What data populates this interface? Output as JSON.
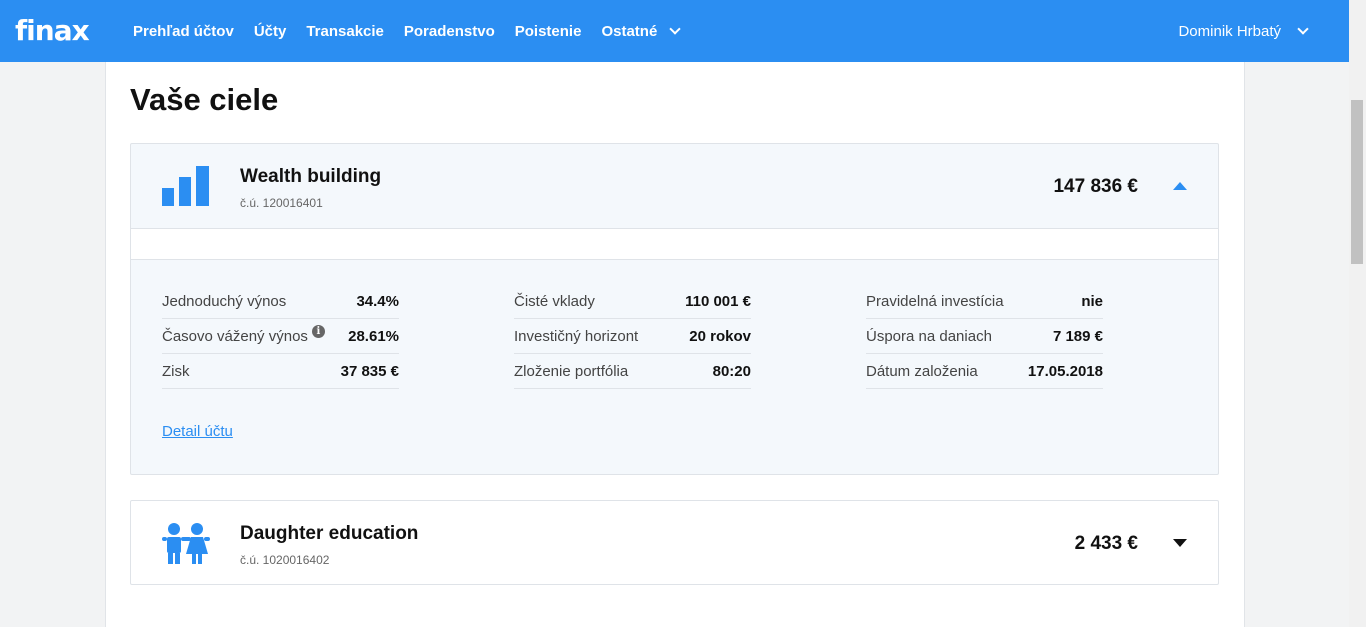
{
  "brand": {
    "logo_text": "finax",
    "primary_color": "#2b8ef2"
  },
  "nav": {
    "items": [
      "Prehľad účtov",
      "Účty",
      "Transakcie",
      "Poradenstvo",
      "Poistenie"
    ],
    "more_label": "Ostatné",
    "user_name": "Dominik Hrbatý"
  },
  "page": {
    "title": "Vaše ciele"
  },
  "goals": [
    {
      "name": "Wealth building",
      "account": "č.ú. 120016401",
      "amount": "147 836 €",
      "icon": "bar-chart-icon",
      "expanded": true,
      "stats": [
        [
          {
            "label": "Jednoduchý výnos",
            "value": "34.4%"
          },
          {
            "label": "Časovo vážený výnos",
            "value": "28.61%",
            "info": "i"
          },
          {
            "label": "Zisk",
            "value": "37 835 €"
          }
        ],
        [
          {
            "label": "Čisté vklady",
            "value": "110 001 €"
          },
          {
            "label": "Investičný horizont",
            "value": "20 rokov"
          },
          {
            "label": "Zloženie portfólia",
            "value": "80:20"
          }
        ],
        [
          {
            "label": "Pravidelná investícia",
            "value": "nie"
          },
          {
            "label": "Úspora na daniach",
            "value": "7 189 €"
          },
          {
            "label": "Dátum založenia",
            "value": "17.05.2018"
          }
        ]
      ],
      "detail_link": "Detail účtu"
    },
    {
      "name": "Daughter education",
      "account": "č.ú. 1020016402",
      "amount": "2 433 €",
      "icon": "children-icon",
      "expanded": false
    }
  ]
}
